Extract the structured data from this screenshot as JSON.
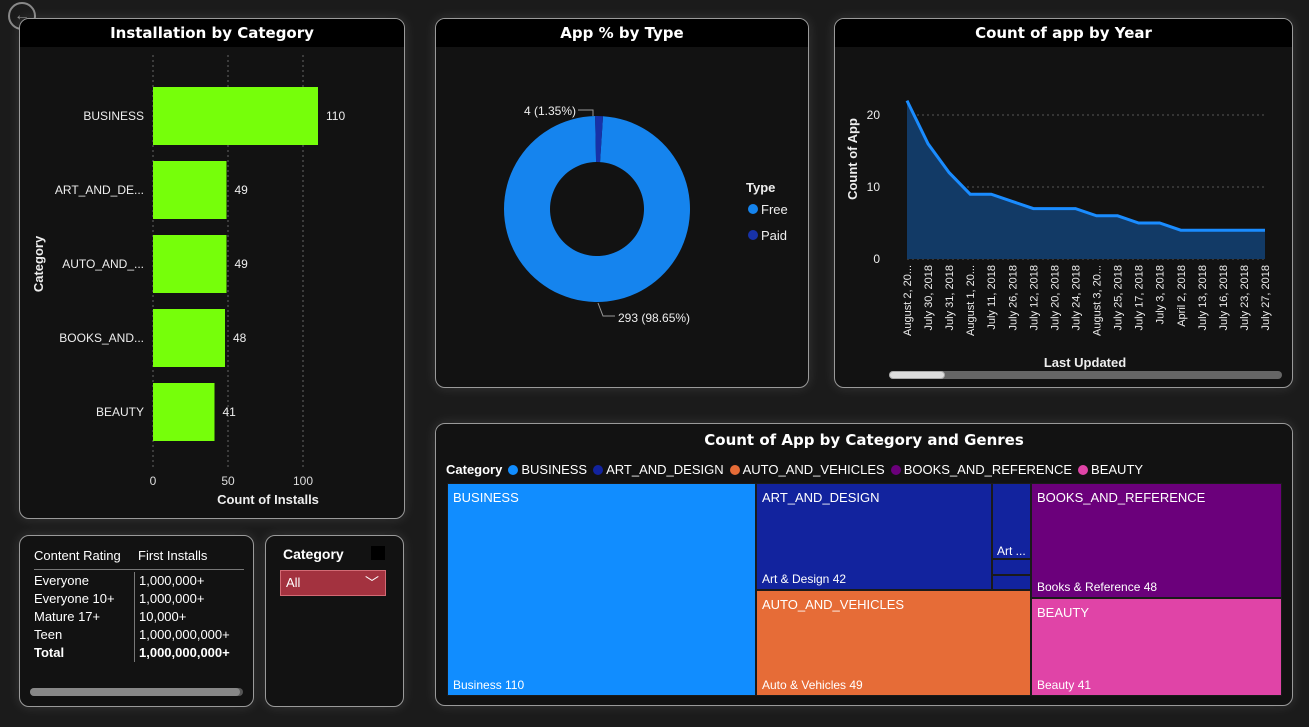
{
  "nav": {
    "back_icon": "back-arrow-icon",
    "back_glyph": "←"
  },
  "installs_chart": {
    "title": "Installation by Category",
    "ylabel": "Category",
    "xlabel": "Count of Installs",
    "bar_color": "#76ff0a"
  },
  "type_chart": {
    "title": "App % by Type",
    "legend_title": "Type",
    "paid_label": "4 (1.35%)",
    "free_label": "293 (98.65%)",
    "colors": {
      "Free": "#1584ee",
      "Paid": "#1732a8"
    }
  },
  "year_chart": {
    "title": "Count of app by Year",
    "ylabel": "Count of App",
    "xlabel": "Last Updated",
    "line_color": "#1a8cff",
    "area_color": "#123a66"
  },
  "treemap": {
    "title": "Count of App by Category and Genres",
    "legend_title": "Category",
    "categories": [
      {
        "name": "BUSINESS",
        "color": "#118dff"
      },
      {
        "name": "ART_AND_DESIGN",
        "color": "#12239e"
      },
      {
        "name": "AUTO_AND_VEHICLES",
        "color": "#e66c37"
      },
      {
        "name": "BOOKS_AND_REFERENCE",
        "color": "#6b007b"
      },
      {
        "name": "BEAUTY",
        "color": "#e044a7"
      }
    ],
    "tiles": {
      "business": {
        "label": "BUSINESS",
        "value": "Business 110"
      },
      "art": {
        "label": "ART_AND_DESIGN",
        "value": "Art & Design 42",
        "sub": "Art ..."
      },
      "auto": {
        "label": "AUTO_AND_VEHICLES",
        "value": "Auto & Vehicles 49"
      },
      "books": {
        "label": "BOOKS_AND_REFERENCE",
        "value": "Books & Reference 48"
      },
      "beauty": {
        "label": "BEAUTY",
        "value": "Beauty 41"
      }
    }
  },
  "rating_table": {
    "headers": [
      "Content Rating",
      "First Installs"
    ],
    "rows": [
      [
        "Everyone",
        "1,000,000+"
      ],
      [
        "Everyone 10+",
        "1,000,000+"
      ],
      [
        "Mature 17+",
        "10,000+"
      ],
      [
        "Teen",
        "1,000,000,000+"
      ]
    ],
    "total": [
      "Total",
      "1,000,000,000+"
    ]
  },
  "slicer": {
    "title": "Category",
    "selected": "All",
    "chevron_icon": "chevron-down-icon",
    "chevron_glyph": "﹀"
  },
  "chart_data": [
    {
      "type": "bar",
      "title": "Installation by Category",
      "xlabel": "Count of Installs",
      "ylabel": "Category",
      "categories": [
        "BUSINESS",
        "ART_AND_DE...",
        "AUTO_AND_...",
        "BOOKS_AND...",
        "BEAUTY"
      ],
      "values": [
        110,
        49,
        49,
        48,
        41
      ],
      "xlim": [
        0,
        120
      ],
      "xticks": [
        0,
        50,
        100
      ],
      "grid": true
    },
    {
      "type": "pie",
      "title": "App % by Type",
      "categories": [
        "Free",
        "Paid"
      ],
      "values": [
        293,
        4
      ],
      "labels": [
        "293 (98.65%)",
        "4 (1.35%)"
      ],
      "legend": "right"
    },
    {
      "type": "area",
      "title": "Count of app by Year",
      "xlabel": "Last Updated",
      "ylabel": "Count of App",
      "categories": [
        "August 2, 20...",
        "July 30, 2018",
        "July 31, 2018",
        "August 1, 20...",
        "July 11, 2018",
        "July 26, 2018",
        "July 12, 2018",
        "July 20, 2018",
        "July 24, 2018",
        "August 3, 20...",
        "July 25, 2018",
        "July 17, 2018",
        "July 3, 2018",
        "April 2, 2018",
        "July 13, 2018",
        "July 16, 2018",
        "July 23, 2018",
        "July 27, 2018"
      ],
      "values": [
        22,
        16,
        12,
        9,
        9,
        8,
        7,
        7,
        7,
        6,
        6,
        5,
        5,
        4,
        4,
        4,
        4,
        4
      ],
      "ylim": [
        0,
        25
      ],
      "yticks": [
        0,
        10,
        20
      ],
      "grid": true
    },
    {
      "type": "treemap",
      "title": "Count of App by Category and Genres",
      "categories": [
        "BUSINESS",
        "ART_AND_DESIGN",
        "AUTO_AND_VEHICLES",
        "BOOKS_AND_REFERENCE",
        "BEAUTY"
      ],
      "values": [
        110,
        42,
        49,
        48,
        41
      ],
      "labels": [
        "Business 110",
        "Art & Design 42",
        "Auto & Vehicles 49",
        "Books & Reference 48",
        "Beauty 41"
      ]
    }
  ]
}
